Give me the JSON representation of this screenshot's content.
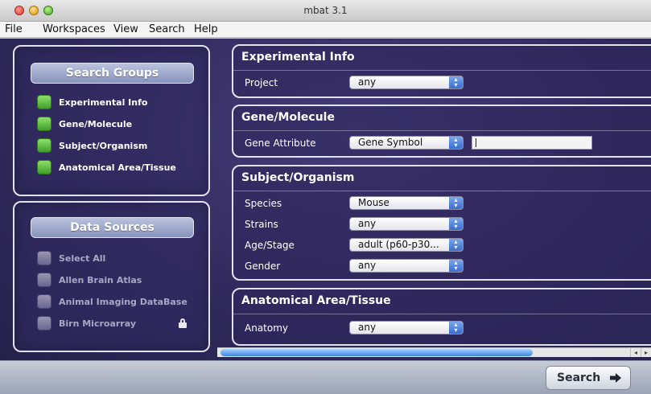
{
  "window": {
    "title": "mbat 3.1"
  },
  "menu": [
    "File",
    "Workspaces",
    "View",
    "Search",
    "Help"
  ],
  "search_groups": {
    "title": "Search Groups",
    "items": [
      {
        "label": "Experimental Info",
        "checked": true
      },
      {
        "label": "Gene/Molecule",
        "checked": true
      },
      {
        "label": "Subject/Organism",
        "checked": true
      },
      {
        "label": "Anatomical Area/Tissue",
        "checked": true
      }
    ]
  },
  "data_sources": {
    "title": "Data Sources",
    "items": [
      {
        "label": "Select All",
        "checked": false
      },
      {
        "label": "Allen Brain Atlas",
        "checked": false
      },
      {
        "label": "Animal Imaging DataBase",
        "checked": false
      },
      {
        "label": "Birn Microarray",
        "checked": false,
        "locked": true
      }
    ]
  },
  "sections": {
    "experimental": {
      "title": "Experimental Info",
      "rows": [
        {
          "label": "Project",
          "value": "any"
        }
      ]
    },
    "gene": {
      "title": "Gene/Molecule",
      "rows": [
        {
          "label": "Gene Attribute",
          "value": "Gene Symbol",
          "text_value": ""
        }
      ]
    },
    "subject": {
      "title": "Subject/Organism",
      "rows": [
        {
          "label": "Species",
          "value": "Mouse"
        },
        {
          "label": "Strains",
          "value": "any"
        },
        {
          "label": "Age/Stage",
          "value": "adult (p60-p30..."
        },
        {
          "label": "Gender",
          "value": "any"
        }
      ]
    },
    "anatomy": {
      "title": "Anatomical Area/Tissue",
      "rows": [
        {
          "label": "Anatomy",
          "value": "any"
        }
      ]
    }
  },
  "footer": {
    "search_button": "Search"
  },
  "colors": {
    "accent_green": "#4aa82a",
    "panel_purple": "#322a5e",
    "select_blue": "#3a6ed0"
  },
  "icons": {
    "search_button": "arrow-right-icon",
    "lock": "lock-icon"
  }
}
